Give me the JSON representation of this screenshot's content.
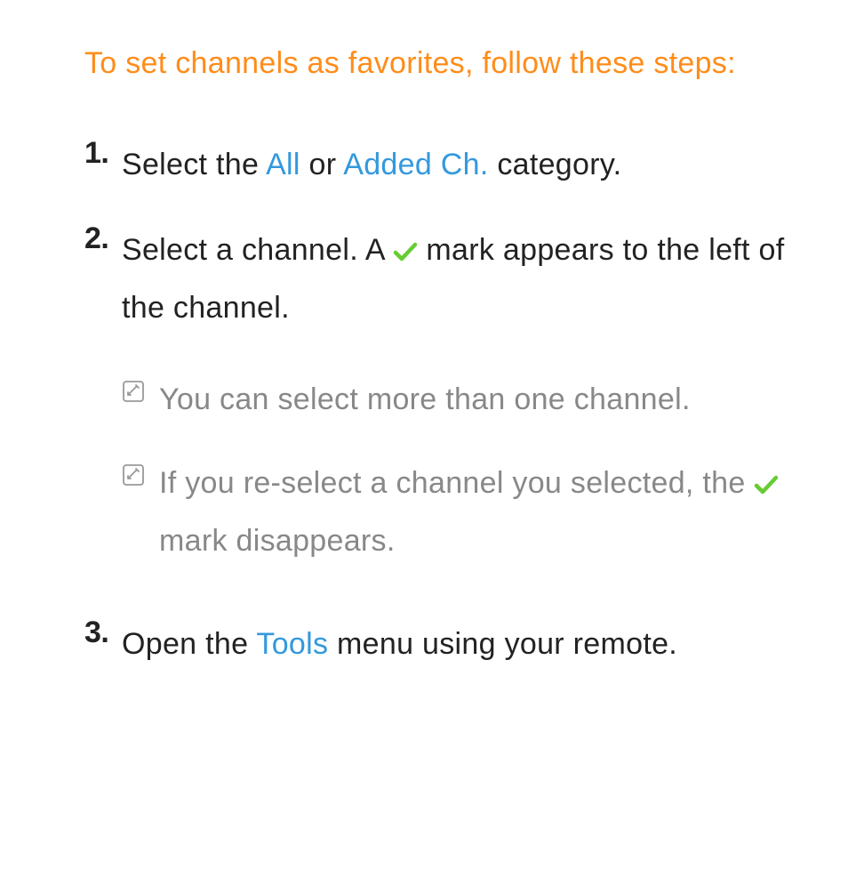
{
  "heading": "To set channels as favorites, follow these steps:",
  "steps": {
    "s1": {
      "num": "1.",
      "t1": "Select the ",
      "hl1": "All",
      "t2": " or ",
      "hl2": "Added Ch.",
      "t3": " category."
    },
    "s2": {
      "num": "2.",
      "t1": "Select a channel. A ",
      "t2": " mark appears to the left of the channel.",
      "note1": "You can select more than one channel.",
      "note2a": "If you re-select a channel you selected, the ",
      "note2b": " mark disappears."
    },
    "s3": {
      "num": "3.",
      "t1": "Open the ",
      "hl1": "Tools",
      "t2": " menu using your remote."
    }
  }
}
